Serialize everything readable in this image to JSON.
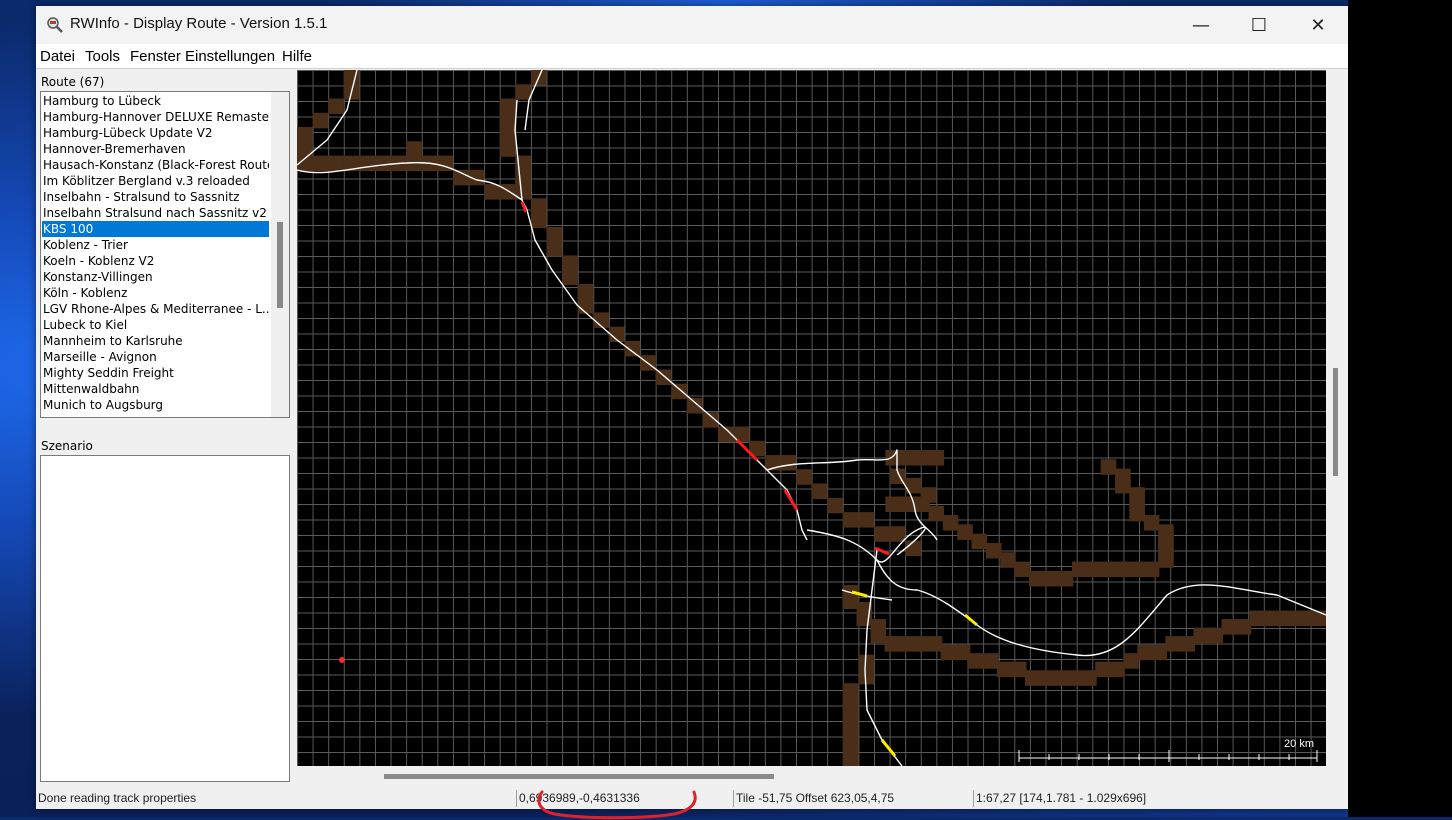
{
  "window": {
    "title": "RWInfo - Display Route - Version 1.5.1",
    "minimize_glyph": "—",
    "maximize_glyph": "☐",
    "close_glyph": "✕"
  },
  "menu": [
    "Datei",
    "Tools",
    "Fenster",
    "Einstellungen",
    "Hilfe"
  ],
  "route_panel": {
    "label": "Route (67)",
    "items": [
      "Hamburg to Lübeck",
      "Hamburg-Hannover DELUXE Remaste...",
      "Hamburg-Lübeck Update V2",
      "Hannover-Bremerhaven",
      "Hausach-Konstanz (Black-Forest Route)",
      "Im Köblitzer Bergland v.3 reloaded",
      "Inselbahn - Stralsund to Sassnitz",
      "Inselbahn Stralsund nach Sassnitz v2",
      "KBS 100",
      "Koblenz - Trier",
      "Koeln - Koblenz V2",
      "Konstanz-Villingen",
      "Köln - Koblenz",
      "LGV Rhone-Alpes & Mediterranee - L...",
      "Lubeck to Kiel",
      "Mannheim to Karlsruhe",
      "Marseille - Avignon",
      "Mighty Seddin Freight",
      "Mittenwaldbahn",
      "Munich to Augsburg"
    ],
    "selected_index": 8
  },
  "scenario_panel": {
    "label": "Szenario"
  },
  "map": {
    "scale_label": "20 km",
    "colors": {
      "background": "#000000",
      "grid": "#5a5a5a",
      "tile": "#4a2e18",
      "track": "#ffffff",
      "highlight_red": "#ff1a1a",
      "highlight_yellow": "#ffee00"
    }
  },
  "status": {
    "message": "Done reading track properties",
    "coords": "0,6936989,-0,4631336",
    "tile": "Tile -51,75 Offset 623,05,4,75",
    "zoom": "1:67,27 [174,1.781 - 1.029x696]"
  }
}
